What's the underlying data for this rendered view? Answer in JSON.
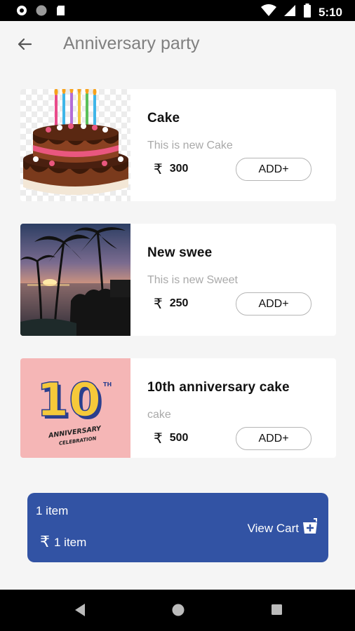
{
  "status_bar": {
    "time": "5:10",
    "left_icons": [
      "notification-icon",
      "circle-icon",
      "sd-card-icon"
    ],
    "right_icons": [
      "wifi-icon",
      "signal-icon",
      "battery-icon"
    ]
  },
  "header": {
    "title": "Anniversary party",
    "back_icon": "arrow-left-icon"
  },
  "products": [
    {
      "name": "Cake",
      "description": "This is new Cake",
      "currency": "₹",
      "price": "300",
      "add_label": "ADD+",
      "image": "chocolate-cake-image"
    },
    {
      "name": "New swee",
      "description": "This is new Sweet",
      "currency": "₹",
      "price": "250",
      "add_label": "ADD+",
      "image": "sunset-palm-image"
    },
    {
      "name": "10th anniversary cake",
      "description": "cake",
      "currency": "₹",
      "price": "500",
      "add_label": "ADD+",
      "image": "anniversary-10-image",
      "image_text": {
        "number": "10",
        "superscript": "TH",
        "line1": "ANNIVERSARY",
        "line2": "CELEBRATION"
      }
    }
  ],
  "cart": {
    "count_label": "1 item",
    "currency": "₹",
    "sub_label": "1 item",
    "view_label": "View Cart",
    "view_icon": "cart-add-icon",
    "color": "#3253a4"
  },
  "nav": {
    "back_icon": "nav-back-icon",
    "home_icon": "nav-home-icon",
    "recents_icon": "nav-recents-icon"
  }
}
